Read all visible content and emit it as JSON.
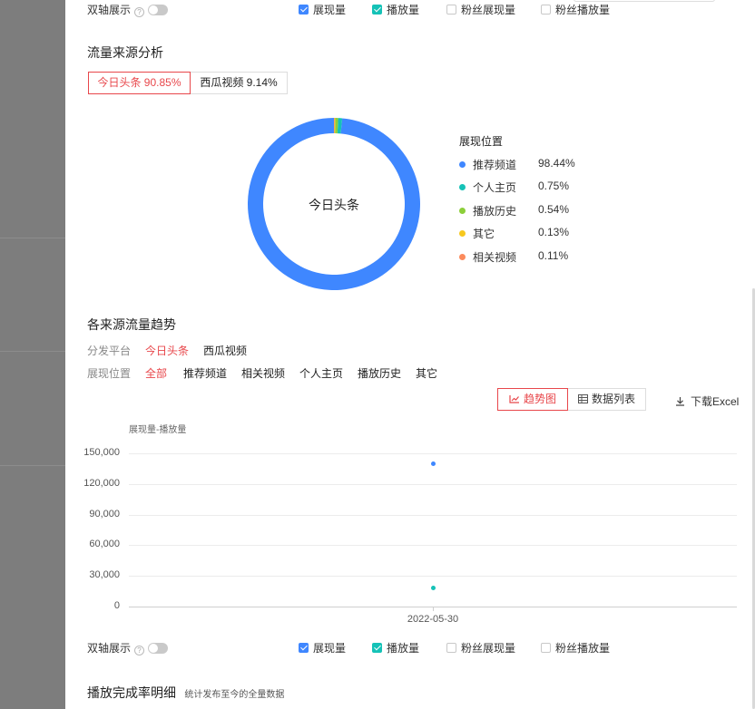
{
  "top_bar": {
    "dual_axis_label": "双轴展示",
    "help": "?",
    "checks": [
      {
        "label": "展现量",
        "checked": true,
        "color": "#3f87ff"
      },
      {
        "label": "播放量",
        "checked": true,
        "color": "#15c2b7"
      },
      {
        "label": "粉丝展现量",
        "checked": false
      },
      {
        "label": "粉丝播放量",
        "checked": false
      }
    ]
  },
  "source": {
    "title": "流量来源分析",
    "tabs": [
      {
        "label": "今日头条 90.85%",
        "active": true
      },
      {
        "label": "西瓜视频 9.14%",
        "active": false
      }
    ],
    "donut_center": "今日头条",
    "legend_title": "展现位置",
    "legend": [
      {
        "label": "推荐频道",
        "pct": "98.44%",
        "value": 98.44,
        "color": "#3f87ff"
      },
      {
        "label": "个人主页",
        "pct": "0.75%",
        "value": 0.75,
        "color": "#15c2b7"
      },
      {
        "label": "播放历史",
        "pct": "0.54%",
        "value": 0.54,
        "color": "#8ccf3a"
      },
      {
        "label": "其它",
        "pct": "0.13%",
        "value": 0.13,
        "color": "#f7c81e"
      },
      {
        "label": "相关视频",
        "pct": "0.11%",
        "value": 0.11,
        "color": "#fb8a5c"
      }
    ]
  },
  "trend": {
    "title": "各来源流量趋势",
    "platform_label": "分发平台",
    "platforms": [
      {
        "label": "今日头条",
        "selected": true
      },
      {
        "label": "西瓜视频",
        "selected": false
      }
    ],
    "position_label": "展现位置",
    "positions": [
      {
        "label": "全部",
        "selected": true
      },
      {
        "label": "推荐频道",
        "selected": false
      },
      {
        "label": "相关视频",
        "selected": false
      },
      {
        "label": "个人主页",
        "selected": false
      },
      {
        "label": "播放历史",
        "selected": false
      },
      {
        "label": "其它",
        "selected": false
      }
    ],
    "view_trend": "趋势图",
    "view_table": "数据列表",
    "download": "下载Excel"
  },
  "chart_data": {
    "type": "scatter",
    "ylabel": "展现量-播放量",
    "x": [
      "2022-05-30"
    ],
    "y_ticks": [
      "150,000",
      "120,000",
      "90,000",
      "60,000",
      "30,000",
      "0"
    ],
    "ylim": [
      0,
      150000
    ],
    "series": [
      {
        "name": "展现量",
        "values": [
          140000
        ],
        "color": "#3f87ff"
      },
      {
        "name": "播放量",
        "values": [
          18000
        ],
        "color": "#15c2b7"
      }
    ]
  },
  "bottom_bar": {
    "dual_axis_label": "双轴展示",
    "help": "?",
    "checks": [
      {
        "label": "展现量",
        "checked": true
      },
      {
        "label": "播放量",
        "checked": true
      },
      {
        "label": "粉丝展现量",
        "checked": false
      },
      {
        "label": "粉丝播放量",
        "checked": false
      }
    ]
  },
  "completion": {
    "title": "播放完成率明细",
    "subtitle": "统计发布至今的全量数据"
  }
}
